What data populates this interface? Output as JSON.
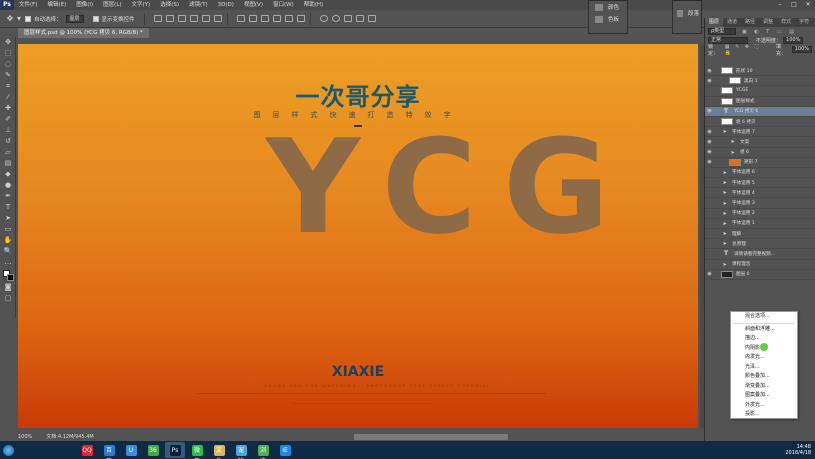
{
  "menubar": {
    "logo": "Ps",
    "items": [
      "文件(F)",
      "编辑(E)",
      "图像(I)",
      "图层(L)",
      "文字(Y)",
      "选择(S)",
      "滤镜(T)",
      "3D(D)",
      "视图(V)",
      "窗口(W)",
      "帮助(H)"
    ]
  },
  "options": {
    "auto_select_label": "自动选择：",
    "auto_select_value": "图层",
    "show_transform_label": "显示变换控件"
  },
  "float_panel_1": {
    "row1": "颜色",
    "row2": "色板"
  },
  "float_panel_2": {
    "label": "段落"
  },
  "document": {
    "tab": "图层样式.psd @ 100% (YCG 拷贝 6, RGB/8) *",
    "zoom": "100%",
    "doc_size": "文档:4.12M/945.4M"
  },
  "canvas": {
    "title": "一次哥分享",
    "subtitle": "图层样式快速打造特效字",
    "big_text": "YCG",
    "bottom_title": "XIAXIE",
    "tiny_line": "THANK YOU FOR WATCHING · PHOTOSHOP TEXT EFFECT TUTORIAL"
  },
  "right_panel": {
    "tabs": [
      "图层",
      "通道",
      "路径",
      "调整",
      "样式",
      "字符"
    ],
    "kind_label": "ρ类型",
    "blend_mode": "正常",
    "opacity_label": "不透明度：",
    "opacity": "100%",
    "lock_label": "锁定：",
    "fill_label": "填充：",
    "fill": "100%"
  },
  "layers": [
    {
      "name": "形状 10",
      "thumb": "white",
      "eye": true,
      "indent": 0,
      "selected": false
    },
    {
      "name": "黑白 1",
      "thumb": "white",
      "eye": true,
      "indent": 1,
      "selected": false
    },
    {
      "name": "YCGE",
      "thumb": "white",
      "eye": false,
      "indent": 0,
      "selected": false
    },
    {
      "name": "图层样式",
      "thumb": "white",
      "eye": false,
      "indent": 0,
      "selected": false
    },
    {
      "name": "YCG 拷贝 6",
      "thumb": "text",
      "eye": true,
      "indent": 0,
      "selected": true
    },
    {
      "name": "组 6 拷贝",
      "thumb": "white",
      "eye": false,
      "indent": 0,
      "selected": false
    },
    {
      "name": "字体运用 7",
      "thumb": "folder",
      "eye": true,
      "indent": 0,
      "selected": false
    },
    {
      "name": "文案",
      "thumb": "folder",
      "eye": true,
      "indent": 1,
      "selected": false
    },
    {
      "name": "组 6",
      "thumb": "folder",
      "eye": true,
      "indent": 1,
      "selected": false
    },
    {
      "name": "矩形 7",
      "thumb": "orange",
      "eye": true,
      "indent": 1,
      "selected": false
    },
    {
      "name": "字体运用 6",
      "thumb": "folder",
      "eye": false,
      "indent": 0,
      "selected": false
    },
    {
      "name": "字体运用 5",
      "thumb": "folder",
      "eye": false,
      "indent": 0,
      "selected": false
    },
    {
      "name": "字体运用 4",
      "thumb": "folder",
      "eye": false,
      "indent": 0,
      "selected": false
    },
    {
      "name": "字体运用 3",
      "thumb": "folder",
      "eye": false,
      "indent": 0,
      "selected": false
    },
    {
      "name": "字体运用 2",
      "thumb": "folder",
      "eye": false,
      "indent": 0,
      "selected": false
    },
    {
      "name": "字体运用 1",
      "thumb": "folder",
      "eye": false,
      "indent": 0,
      "selected": false
    },
    {
      "name": "理解",
      "thumb": "folder",
      "eye": false,
      "indent": 0,
      "selected": false
    },
    {
      "name": "总原理",
      "thumb": "folder",
      "eye": false,
      "indent": 0,
      "selected": false
    },
    {
      "name": "详情请看完整视频...",
      "thumb": "text",
      "eye": false,
      "indent": 0,
      "selected": false
    },
    {
      "name": "课程理念",
      "thumb": "folder",
      "eye": false,
      "indent": 0,
      "selected": false
    },
    {
      "name": "图层 0",
      "thumb": "dark",
      "eye": true,
      "indent": 0,
      "selected": false
    }
  ],
  "context_menu": {
    "items": [
      "混合选项...",
      "斜面和浮雕...",
      "描边...",
      "内阴影...",
      "内发光...",
      "光泽...",
      "颜色叠加...",
      "渐变叠加...",
      "图案叠加...",
      "外发光...",
      "投影..."
    ]
  },
  "taskbar": {
    "apps": [
      "QQ",
      "百度",
      "U",
      "360",
      "Ps",
      "微信",
      "文件",
      "宠物",
      "浏览器",
      "IE"
    ],
    "time": "14:48",
    "date": "2018/4/18"
  }
}
